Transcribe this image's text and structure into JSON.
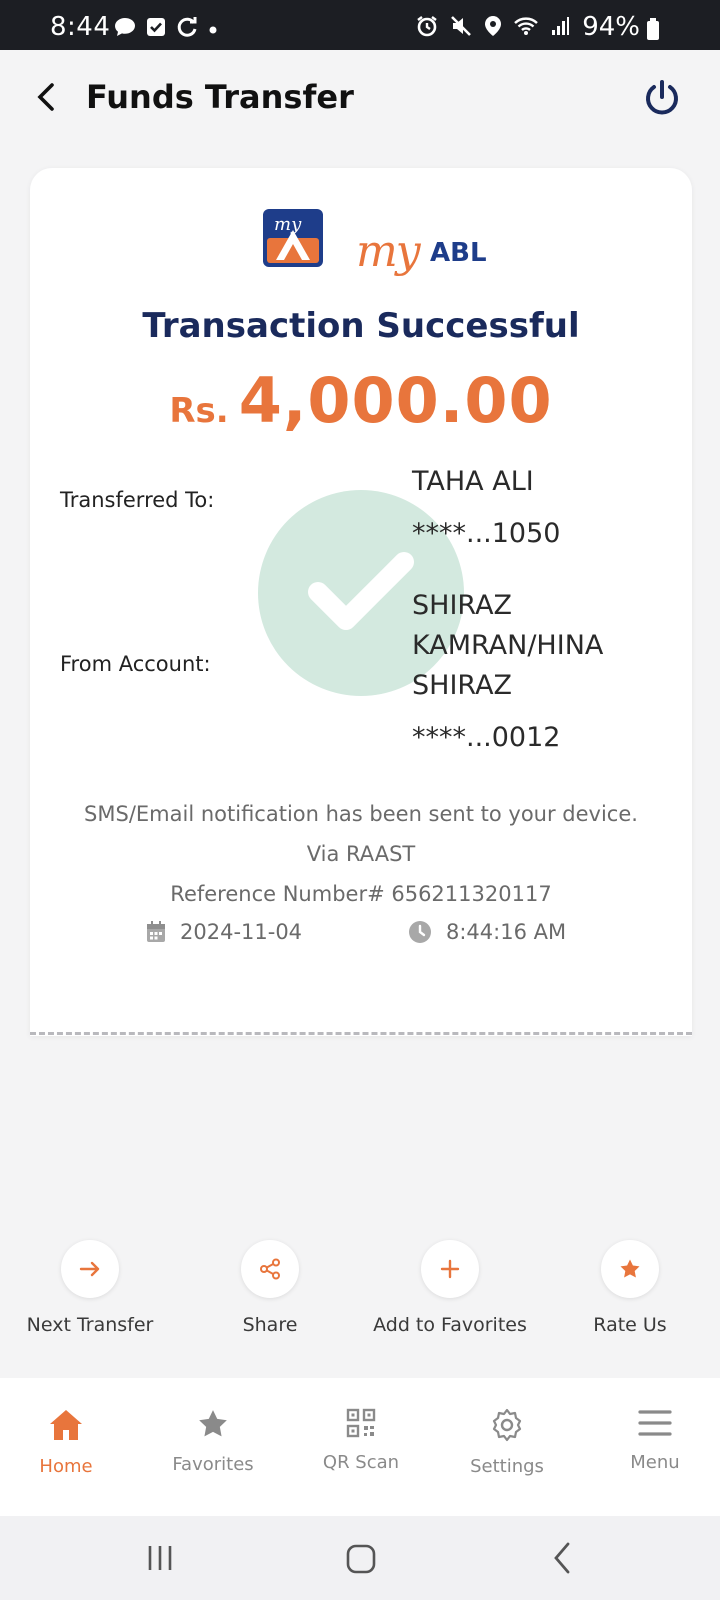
{
  "status_bar": {
    "time": "8:44",
    "battery": "94%",
    "left_icons": [
      "chat-icon",
      "check-square-icon",
      "sync-icon",
      "dot-icon"
    ],
    "right_icons": [
      "alarm-icon",
      "mute-icon",
      "location-icon",
      "wifi-icon",
      "signal-icon",
      "battery-icon"
    ]
  },
  "header": {
    "title": "Funds Transfer"
  },
  "receipt": {
    "logo_my": "my",
    "logo_abl": "ABL",
    "title": "Transaction Successful",
    "currency": "Rs.",
    "amount": "4,000.00",
    "transferred_to_label": "Transferred To:",
    "to_name": "TAHA ALI",
    "to_account": "****...1050",
    "from_account_label": "From Account:",
    "from_name_line1": "SHIRAZ",
    "from_name_line2": "KAMRAN/HINA",
    "from_name_line3": "SHIRAZ",
    "from_account": "****...0012",
    "notification": "SMS/Email notification has been sent to your device.",
    "via": "Via RAAST",
    "reference": "Reference Number# 656211320117",
    "date": "2024-11-04",
    "time": "8:44:16 AM"
  },
  "actions": [
    {
      "label": "Next Transfer",
      "icon": "arrow-right-icon"
    },
    {
      "label": "Share",
      "icon": "share-icon"
    },
    {
      "label": "Add to Favorites",
      "icon": "plus-icon"
    },
    {
      "label": "Rate Us",
      "icon": "star-icon"
    }
  ],
  "bottom_nav": [
    {
      "label": "Home",
      "icon": "home-icon",
      "active": true
    },
    {
      "label": "Favorites",
      "icon": "star-icon",
      "active": false
    },
    {
      "label": "QR Scan",
      "icon": "qr-icon",
      "active": false
    },
    {
      "label": "Settings",
      "icon": "gear-icon",
      "active": false
    },
    {
      "label": "Menu",
      "icon": "menu-icon",
      "active": false
    }
  ],
  "colors": {
    "accent": "#e8753c",
    "navy": "#1a2a5c",
    "success_circle": "#d3e9df"
  }
}
